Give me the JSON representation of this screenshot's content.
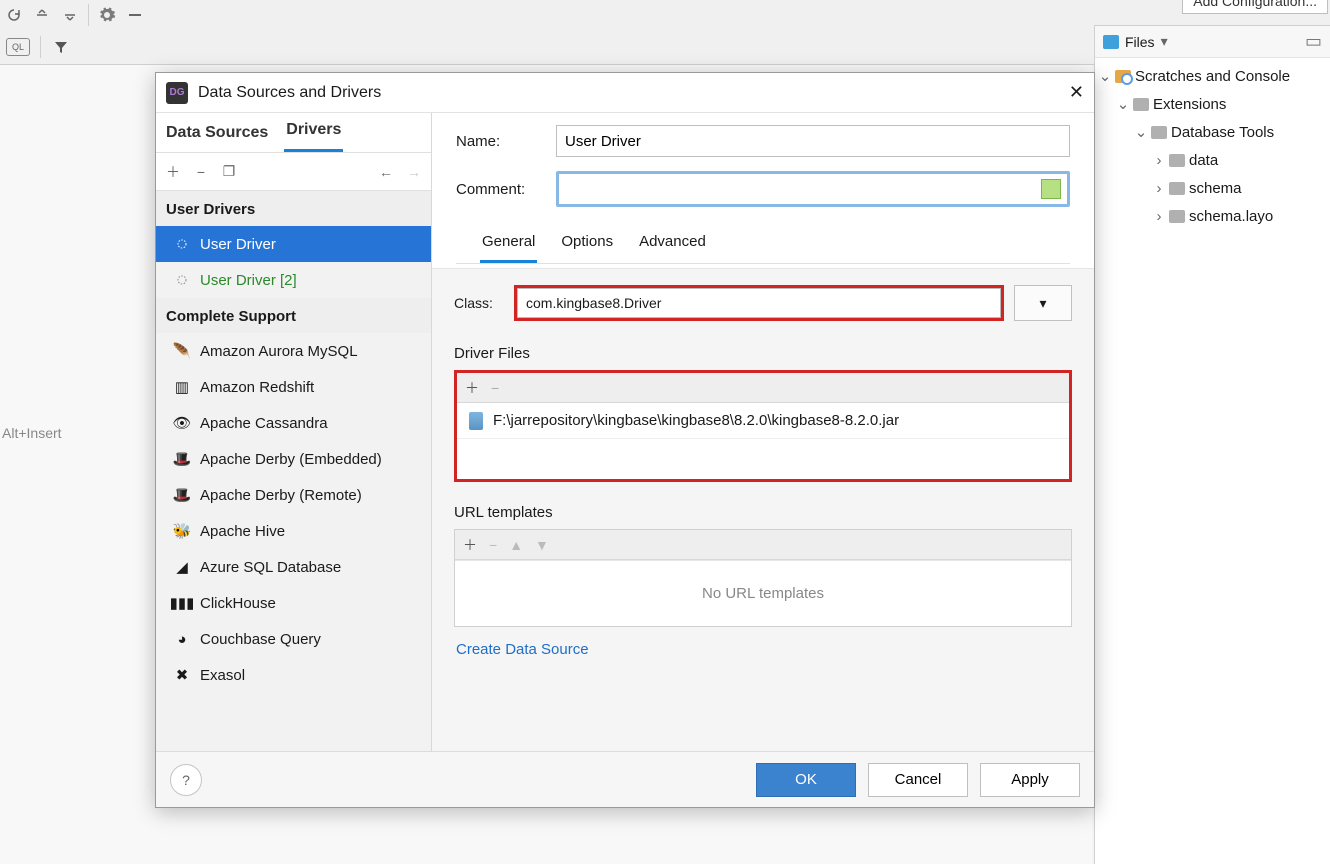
{
  "bg": {
    "hint": "Alt+Insert",
    "add_config": "Add Configuration..."
  },
  "files_dropdown": "Files",
  "tree": {
    "root": "Scratches and Console",
    "ext": "Extensions",
    "dbt": "Database Tools",
    "items": [
      "data",
      "schema",
      "schema.layo"
    ]
  },
  "dialog": {
    "title": "Data Sources and Drivers",
    "tabs": {
      "data_sources": "Data Sources",
      "drivers": "Drivers"
    },
    "user_drivers_header": "User Drivers",
    "complete_support_header": "Complete Support",
    "driver_list": {
      "user": [
        "User Driver",
        "User Driver [2]"
      ],
      "complete": [
        "Amazon Aurora MySQL",
        "Amazon Redshift",
        "Apache Cassandra",
        "Apache Derby (Embedded)",
        "Apache Derby (Remote)",
        "Apache Hive",
        "Azure SQL Database",
        "ClickHouse",
        "Couchbase Query",
        "Exasol"
      ]
    },
    "form": {
      "name_label": "Name:",
      "name_value": "User Driver",
      "comment_label": "Comment:",
      "comment_value": "",
      "tabs": {
        "general": "General",
        "options": "Options",
        "advanced": "Advanced"
      },
      "class_label": "Class:",
      "class_value": "com.kingbase8.Driver",
      "driver_files_label": "Driver Files",
      "jar_path": "F:\\jarrepository\\kingbase\\kingbase8\\8.2.0\\kingbase8-8.2.0.jar",
      "url_templates_label": "URL templates",
      "url_empty": "No URL templates",
      "create_link": "Create Data Source"
    },
    "buttons": {
      "ok": "OK",
      "cancel": "Cancel",
      "apply": "Apply"
    }
  }
}
